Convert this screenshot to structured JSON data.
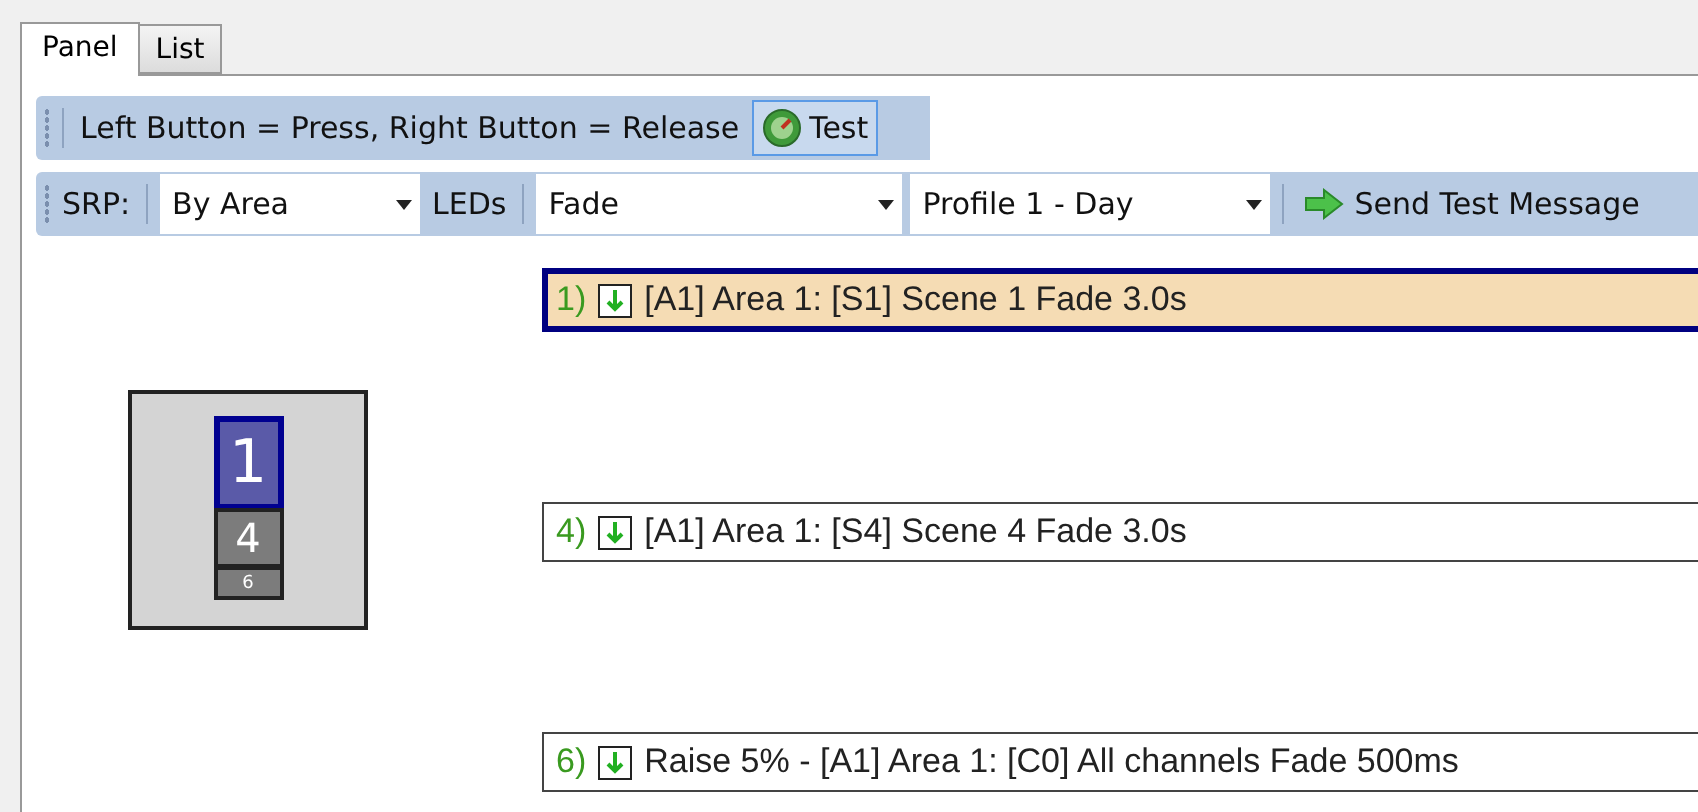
{
  "tabs": [
    {
      "label": "Panel",
      "selected": true
    },
    {
      "label": "List",
      "selected": false
    }
  ],
  "button_toolbar": {
    "label": "Left Button = Press, Right Button = Release",
    "test_button": "Test"
  },
  "settings_toolbar": {
    "srp_label": "SRP:",
    "srp_value": "By Area",
    "leds_label": "LEDs",
    "leds_value": "Fade",
    "profile_value": "Profile 1 - Day",
    "send_button": "Send Test Message"
  },
  "keypad": [
    {
      "label": "1",
      "selected": true
    },
    {
      "label": "4",
      "selected": false
    },
    {
      "label": "6",
      "selected": false
    }
  ],
  "actions": [
    {
      "number": "1)",
      "text": "[A1] Area 1: [S1] Scene 1 Fade 3.0s",
      "selected": true
    },
    {
      "number": "4)",
      "text": "[A1] Area 1: [S4] Scene 4 Fade 3.0s",
      "selected": false
    },
    {
      "number": "6)",
      "text": "Raise 5% - [A1] Area 1: [C0] All channels Fade 500ms",
      "selected": false
    }
  ]
}
